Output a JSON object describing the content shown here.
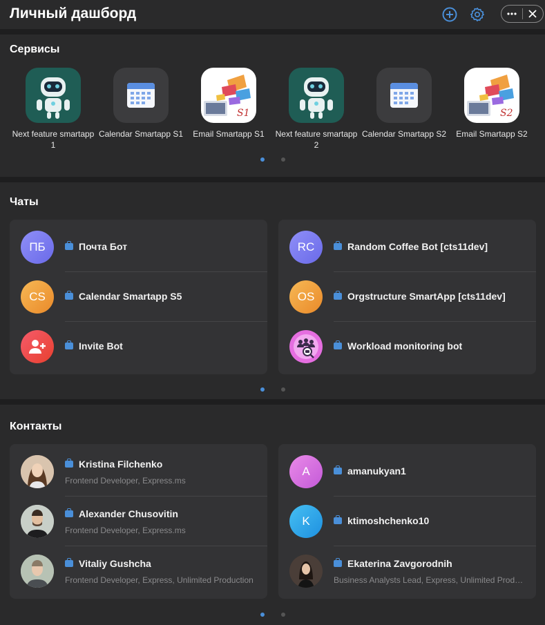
{
  "header": {
    "title": "Личный дашборд",
    "icons": [
      "plus-circle-icon",
      "gear-icon",
      "more-icon",
      "close-icon"
    ],
    "accent": "#4a8fd9"
  },
  "services": {
    "title": "Сервисы",
    "items": [
      {
        "label": "Next feature smartapp 1",
        "icon": "robot-icon"
      },
      {
        "label": "Calendar Smartapp S1",
        "icon": "calendar-icon"
      },
      {
        "label": "Email Smartapp S1",
        "icon": "email-icon",
        "badge": "S1"
      },
      {
        "label": "Next feature smartapp 2",
        "icon": "robot-icon"
      },
      {
        "label": "Calendar Smartapp S2",
        "icon": "calendar-icon"
      },
      {
        "label": "Email Smartapp S2",
        "icon": "email-icon",
        "badge": "S2"
      }
    ],
    "page": 1,
    "pages": 2
  },
  "chats": {
    "title": "Чаты",
    "left": [
      {
        "initials": "ПБ",
        "name": "Почта Бот",
        "color": "#7b7ff0"
      },
      {
        "initials": "CS",
        "name": "Calendar Smartapp S5",
        "color": "#f0a040"
      },
      {
        "initials": "",
        "name": "Invite Bot",
        "color": "#f04a4a",
        "icon": "add-user-icon"
      }
    ],
    "right": [
      {
        "initials": "RC",
        "name": "Random Coffee Bot [cts11dev]",
        "color": "#7b7ff0"
      },
      {
        "initials": "OS",
        "name": "Orgstructure SmartApp [cts11dev]",
        "color": "#f0a040"
      },
      {
        "initials": "",
        "name": "Workload monitoring bot",
        "color": "#e070e0",
        "icon": "team-search-icon"
      }
    ],
    "page": 1,
    "pages": 2
  },
  "contacts": {
    "title": "Контакты",
    "left": [
      {
        "name": "Kristina Filchenko",
        "role": "Frontend Developer, Express.ms",
        "photo": "user-photo"
      },
      {
        "name": "Alexander Chusovitin",
        "role": "Frontend Developer, Express.ms",
        "photo": "user-photo"
      },
      {
        "name": "Vitaliy Gushcha",
        "role": "Frontend Developer, Express, Unlimited Production",
        "photo": "user-photo"
      }
    ],
    "right": [
      {
        "name": "amanukyan1",
        "initials": "A",
        "color": "#d070e0"
      },
      {
        "name": "ktimoshchenko10",
        "initials": "K",
        "color": "#30a8e8"
      },
      {
        "name": "Ekaterina Zavgorodnih",
        "role": "Business Analysts Lead, Express, Unlimited Production",
        "photo": "user-photo"
      }
    ],
    "page": 1,
    "pages": 2
  }
}
